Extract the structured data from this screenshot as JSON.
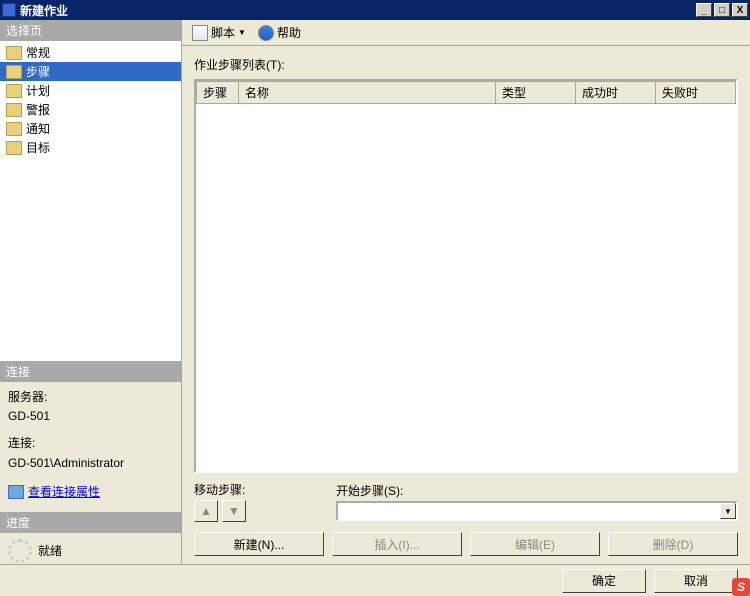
{
  "window": {
    "title": "新建作业"
  },
  "leftpane": {
    "select_header": "选择页",
    "nav_items": [
      "常规",
      "步骤",
      "计划",
      "警报",
      "通知",
      "目标"
    ],
    "selected_index": 1,
    "conn_header": "连接",
    "server_label": "服务器:",
    "server_value": "GD-501",
    "conn_label": "连接:",
    "conn_value": "GD-501\\Administrator",
    "view_conn_props": "查看连接属性",
    "progress_header": "进度",
    "progress_status": "就绪"
  },
  "toolbar": {
    "script": "脚本",
    "help": "帮助"
  },
  "main": {
    "list_label": "作业步骤列表(T):",
    "col_step": "步骤",
    "col_name": "名称",
    "col_type": "类型",
    "col_on_success": "成功时",
    "col_on_fail": "失败时",
    "move_label": "移动步骤:",
    "start_label": "开始步骤(S):",
    "btn_new": "新建(N)...",
    "btn_insert": "插入(I)...",
    "btn_edit": "编辑(E)",
    "btn_delete": "删除(D)"
  },
  "footer": {
    "ok": "确定",
    "cancel": "取消"
  },
  "badge": "S"
}
